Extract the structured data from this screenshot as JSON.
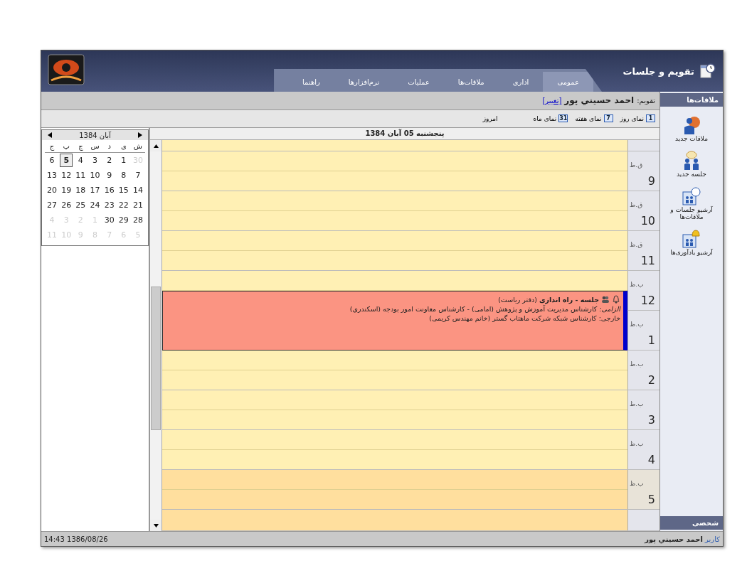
{
  "app": {
    "title": "تقویم و جلسات"
  },
  "tabs": [
    {
      "label": "عمومی",
      "selected": true
    },
    {
      "label": "اداری",
      "selected": false
    },
    {
      "label": "ملاقات‌ها",
      "selected": false
    },
    {
      "label": "عملیات",
      "selected": false
    },
    {
      "label": "نرم‌افزارها",
      "selected": false
    },
    {
      "label": "راهنما",
      "selected": false
    }
  ],
  "calendar_owner": {
    "label": "تقویم:",
    "name": "احمد حسيني پور",
    "link": "[تغییر]"
  },
  "toolbar": [
    {
      "kind": "view",
      "icon_number": "1",
      "label": "نمای روز"
    },
    {
      "kind": "view",
      "icon_number": "7",
      "label": "نمای هفته"
    },
    {
      "kind": "view",
      "icon_number": "31",
      "label": "نمای ماه"
    },
    {
      "kind": "today",
      "label": "امروز"
    }
  ],
  "sidebar": {
    "header": "ملاقات‌ها",
    "footer": "شخصی",
    "items": [
      {
        "kind": "new-meeting",
        "label": "ملاقات جديد"
      },
      {
        "kind": "new-session",
        "label": "جلسه جديد"
      },
      {
        "kind": "archive",
        "label": "آرشیو جلسات و ملاقات‌ها"
      },
      {
        "kind": "reminders",
        "label": "آرشیو یادآوری‌ها"
      }
    ]
  },
  "mini_calendar": {
    "month": "آبان 1384",
    "weekdays": [
      "ش",
      "ی",
      "د",
      "س",
      "چ",
      "پ",
      "ج"
    ],
    "weeks": [
      [
        {
          "day": "30",
          "muted": true,
          "selected": false
        },
        {
          "day": "1",
          "muted": false,
          "selected": false
        },
        {
          "day": "2",
          "muted": false,
          "selected": false
        },
        {
          "day": "3",
          "muted": false,
          "selected": false
        },
        {
          "day": "4",
          "muted": false,
          "selected": false
        },
        {
          "day": "5",
          "muted": false,
          "selected": true
        },
        {
          "day": "6",
          "muted": false,
          "selected": false
        }
      ],
      [
        {
          "day": "7",
          "muted": false,
          "selected": false
        },
        {
          "day": "8",
          "muted": false,
          "selected": false
        },
        {
          "day": "9",
          "muted": false,
          "selected": false
        },
        {
          "day": "10",
          "muted": false,
          "selected": false
        },
        {
          "day": "11",
          "muted": false,
          "selected": false
        },
        {
          "day": "12",
          "muted": false,
          "selected": false
        },
        {
          "day": "13",
          "muted": false,
          "selected": false
        }
      ],
      [
        {
          "day": "14",
          "muted": false,
          "selected": false
        },
        {
          "day": "15",
          "muted": false,
          "selected": false
        },
        {
          "day": "16",
          "muted": false,
          "selected": false
        },
        {
          "day": "17",
          "muted": false,
          "selected": false
        },
        {
          "day": "18",
          "muted": false,
          "selected": false
        },
        {
          "day": "19",
          "muted": false,
          "selected": false
        },
        {
          "day": "20",
          "muted": false,
          "selected": false
        }
      ],
      [
        {
          "day": "21",
          "muted": false,
          "selected": false
        },
        {
          "day": "22",
          "muted": false,
          "selected": false
        },
        {
          "day": "23",
          "muted": false,
          "selected": false
        },
        {
          "day": "24",
          "muted": false,
          "selected": false
        },
        {
          "day": "25",
          "muted": false,
          "selected": false
        },
        {
          "day": "26",
          "muted": false,
          "selected": false
        },
        {
          "day": "27",
          "muted": false,
          "selected": false
        }
      ],
      [
        {
          "day": "28",
          "muted": false,
          "selected": false
        },
        {
          "day": "29",
          "muted": false,
          "selected": false
        },
        {
          "day": "30",
          "muted": false,
          "selected": false
        },
        {
          "day": "1",
          "muted": true,
          "selected": false
        },
        {
          "day": "2",
          "muted": true,
          "selected": false
        },
        {
          "day": "3",
          "muted": true,
          "selected": false
        },
        {
          "day": "4",
          "muted": true,
          "selected": false
        }
      ],
      [
        {
          "day": "5",
          "muted": true,
          "selected": false
        },
        {
          "day": "6",
          "muted": true,
          "selected": false
        },
        {
          "day": "7",
          "muted": true,
          "selected": false
        },
        {
          "day": "8",
          "muted": true,
          "selected": false
        },
        {
          "day": "9",
          "muted": true,
          "selected": false
        },
        {
          "day": "10",
          "muted": true,
          "selected": false
        },
        {
          "day": "11",
          "muted": true,
          "selected": false
        }
      ]
    ]
  },
  "day_view": {
    "date": "پنجشنبه 05 آبان 1384",
    "rows": [
      {
        "hour": "9",
        "period": "ق.ظ",
        "shaded": false
      },
      {
        "hour": "10",
        "period": "ق.ظ",
        "shaded": false
      },
      {
        "hour": "11",
        "period": "ق.ظ",
        "shaded": false
      },
      {
        "hour": "12",
        "period": "ب.ظ",
        "shaded": false
      },
      {
        "hour": "1",
        "period": "ب.ظ",
        "shaded": false
      },
      {
        "hour": "2",
        "period": "ب.ظ",
        "shaded": false
      },
      {
        "hour": "3",
        "period": "ب.ظ",
        "shaded": false
      },
      {
        "hour": "4",
        "period": "ب.ظ",
        "shaded": false
      },
      {
        "hour": "5",
        "period": "ب.ظ",
        "shaded": true
      }
    ],
    "events": [
      {
        "title": "جلسه - راه اندازی",
        "location": "(دفتر ریاست)",
        "lines": [
          "*الزامی:* کارشناس مدیریت آموزش و پژوهش (امامی) - کارشناس معاونت امور بودجه (اسکندری)",
          "خارجی: کارشناس شبکه شرکت ماهتاب گستر (خانم مهندس کریمی)"
        ]
      }
    ]
  },
  "status_bar": {
    "datetime": "1386/08/26 14:43",
    "user_label": "کاربر",
    "user_name": "احمد حسيني پور"
  }
}
